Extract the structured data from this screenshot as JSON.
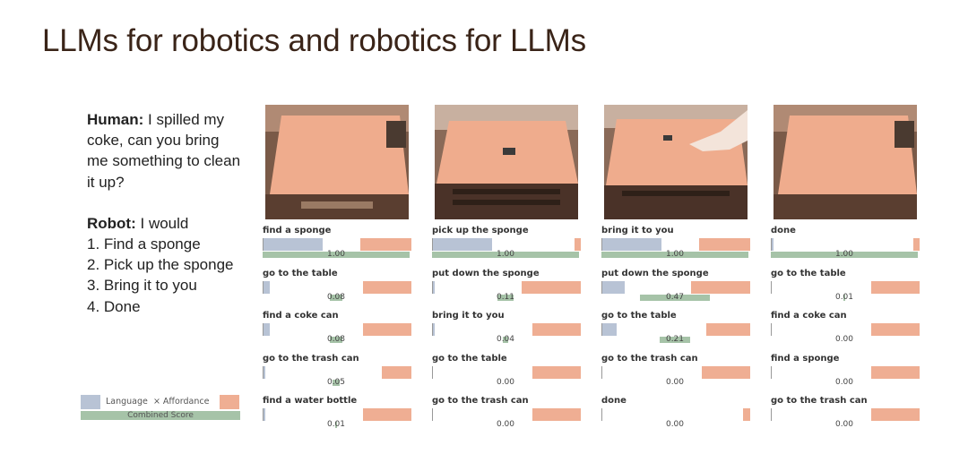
{
  "title": "LLMs for robotics and robotics for LLMs",
  "dialog": {
    "human_label": "Human:",
    "human_text": "I spilled my coke, can you bring me something to clean it up?",
    "robot_label": "Robot:",
    "robot_intro": "I would",
    "robot_steps": [
      "1. Find a sponge",
      "2. Pick up the sponge",
      "3. Bring it to you",
      "4. Done"
    ]
  },
  "legend": {
    "language": "Language",
    "affordance": "× Affordance",
    "combined": "Combined Score"
  },
  "colors": {
    "language": "#b8c3d5",
    "affordance": "#efae93",
    "combined": "#a6c3a8"
  },
  "chart_data": [
    {
      "type": "bar",
      "categories": [
        "find a sponge",
        "go to the table",
        "find a coke can",
        "go to the trash can",
        "find a water bottle"
      ],
      "language": [
        0.4,
        0.04,
        0.04,
        0.01,
        0.01
      ],
      "affordance": [
        0.35,
        0.33,
        0.33,
        0.2,
        0.33
      ],
      "combined_labels": [
        "1.00",
        "0.08",
        "0.08",
        "0.05",
        "0.01"
      ],
      "combined": [
        1.0,
        0.08,
        0.08,
        0.05,
        0.01
      ]
    },
    {
      "type": "bar",
      "categories": [
        "pick up the sponge",
        "put down the sponge",
        "bring it to you",
        "go to the table",
        "go to the trash can"
      ],
      "language": [
        0.4,
        0.01,
        0.01,
        0.0,
        0.0
      ],
      "affordance": [
        0.04,
        0.4,
        0.33,
        0.33,
        0.33
      ],
      "combined_labels": [
        "1.00",
        "0.11",
        "0.04",
        "0.00",
        "0.00"
      ],
      "combined": [
        1.0,
        0.11,
        0.04,
        0.0,
        0.0
      ]
    },
    {
      "type": "bar",
      "categories": [
        "bring it to you",
        "put down the sponge",
        "go to the table",
        "go to the trash can",
        "done"
      ],
      "language": [
        0.4,
        0.15,
        0.1,
        0.0,
        0.0
      ],
      "affordance": [
        0.35,
        0.4,
        0.3,
        0.33,
        0.05
      ],
      "combined_labels": [
        "1.00",
        "0.47",
        "0.21",
        "0.00",
        "0.00"
      ],
      "combined": [
        1.0,
        0.47,
        0.21,
        0.0,
        0.0
      ]
    },
    {
      "type": "bar",
      "categories": [
        "done",
        "go to the table",
        "find a coke can",
        "find a sponge",
        "go to the trash can"
      ],
      "language": [
        0.01,
        0.0,
        0.0,
        0.0,
        0.0
      ],
      "affordance": [
        0.04,
        0.33,
        0.33,
        0.33,
        0.33
      ],
      "combined_labels": [
        "1.00",
        "0.01",
        "0.00",
        "0.00",
        "0.00"
      ],
      "combined": [
        1.0,
        0.01,
        0.0,
        0.0,
        0.0
      ]
    }
  ]
}
